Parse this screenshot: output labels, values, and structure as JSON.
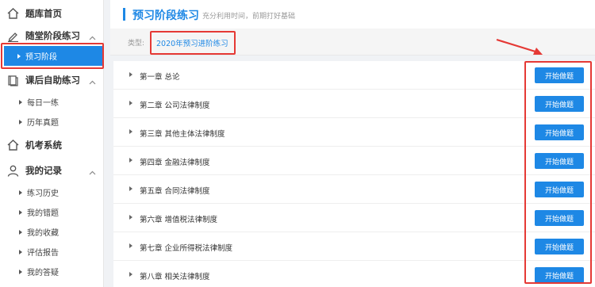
{
  "sidebar": {
    "sections": [
      {
        "label": "题库首页",
        "icon": "home-icon"
      },
      {
        "label": "随堂阶段练习",
        "icon": "edit-icon"
      },
      {
        "label": "课后自助练习",
        "icon": "book-icon"
      },
      {
        "label": "机考系统",
        "icon": "home-icon"
      },
      {
        "label": "我的记录",
        "icon": "user-icon"
      }
    ],
    "items": [
      {
        "label": "预习阶段",
        "active": true
      },
      {
        "label": "每日一练"
      },
      {
        "label": "历年真题"
      },
      {
        "label": "练习历史"
      },
      {
        "label": "我的错题"
      },
      {
        "label": "我的收藏"
      },
      {
        "label": "评估报告"
      },
      {
        "label": "我的答疑"
      }
    ]
  },
  "header": {
    "title": "预习阶段练习",
    "subtitle": "充分利用时间，前期打好基础"
  },
  "type_filter": {
    "label": "类型:",
    "value": "2020年预习进阶练习"
  },
  "chapters": [
    {
      "name": "第一章 总论",
      "button": "开始做题"
    },
    {
      "name": "第二章 公司法律制度",
      "button": "开始做题"
    },
    {
      "name": "第三章 其他主体法律制度",
      "button": "开始做题"
    },
    {
      "name": "第四章 金融法律制度",
      "button": "开始做题"
    },
    {
      "name": "第五章 合同法律制度",
      "button": "开始做题"
    },
    {
      "name": "第六章 增值税法律制度",
      "button": "开始做题"
    },
    {
      "name": "第七章 企业所得税法律制度",
      "button": "开始做题"
    },
    {
      "name": "第八章 相关法律制度",
      "button": "开始做题"
    }
  ],
  "colors": {
    "accent": "#1e88e5",
    "highlight": "#e53935"
  }
}
